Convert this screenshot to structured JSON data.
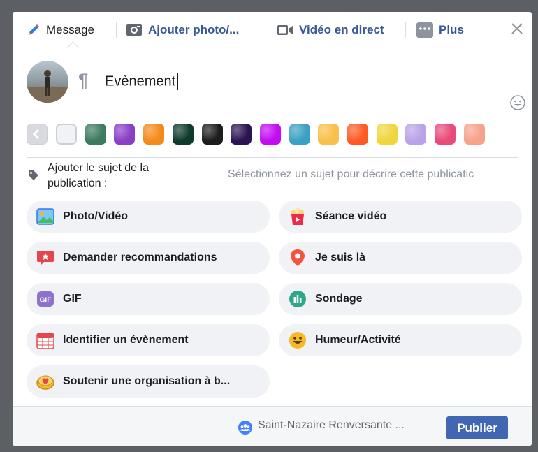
{
  "tabs": {
    "message": "Message",
    "add_photo": "Ajouter photo/...",
    "live_video": "Vidéo en direct",
    "more": "Plus"
  },
  "composer": {
    "paragraph_symbol": "¶",
    "text": "Evènement"
  },
  "background_swatches": [
    {
      "name": "plain-white",
      "color": "#f0f2f5"
    },
    {
      "name": "green-texture",
      "color": "#3d7a5e"
    },
    {
      "name": "purple-blobs",
      "color": "#8a3fc7"
    },
    {
      "name": "orange-fruit",
      "color": "#f48a1a"
    },
    {
      "name": "dark-green-sparkle",
      "color": "#0e3b2c"
    },
    {
      "name": "black",
      "color": "#1c1c1c"
    },
    {
      "name": "dark-purple",
      "color": "#2b1454"
    },
    {
      "name": "magenta",
      "color": "#c30cf2"
    },
    {
      "name": "teal-gradient",
      "color": "#3aa0c4"
    },
    {
      "name": "yellow-pattern",
      "color": "#f7c04a"
    },
    {
      "name": "orange-red",
      "color": "#ff5a24"
    },
    {
      "name": "yellow-green",
      "color": "#f2d53c"
    },
    {
      "name": "lavender-dots",
      "color": "#b8a2e8"
    },
    {
      "name": "pink-orange",
      "color": "#e84a7a"
    },
    {
      "name": "peach-coral",
      "color": "#f5a38a"
    }
  ],
  "topic": {
    "label": "Ajouter le sujet de la publication :",
    "placeholder": "Sélectionnez un sujet pour décrire cette publicatic"
  },
  "actions": [
    {
      "label": "Photo/Vidéo",
      "icon": "photo-icon"
    },
    {
      "label": "Séance vidéo",
      "icon": "popcorn-icon"
    },
    {
      "label": "Demander recommandations",
      "icon": "recommendation-icon"
    },
    {
      "label": "Je suis là",
      "icon": "location-pin-icon"
    },
    {
      "label": "GIF",
      "icon": "gif-icon"
    },
    {
      "label": "Sondage",
      "icon": "poll-icon"
    },
    {
      "label": "Identifier un évènement",
      "icon": "calendar-icon"
    },
    {
      "label": "Humeur/Activité",
      "icon": "smiley-icon"
    },
    {
      "label": "Soutenir une organisation à b...",
      "icon": "donate-heart-icon"
    }
  ],
  "footer": {
    "audience": "Saint-Nazaire Renversante ...",
    "publish": "Publier"
  },
  "colors": {
    "accent": "#4267b2",
    "link": "#385898",
    "pill_bg": "#f0f2f5"
  }
}
